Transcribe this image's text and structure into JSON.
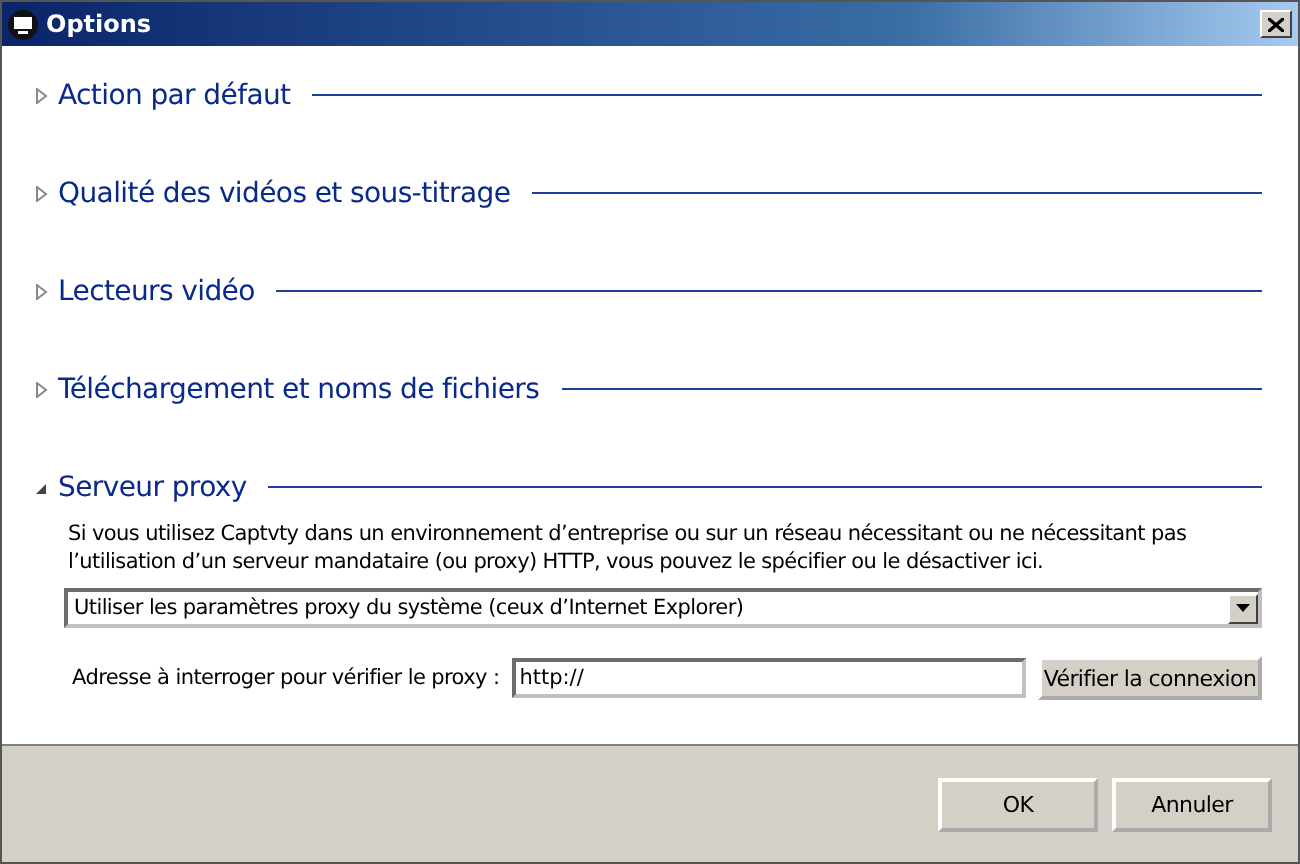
{
  "window": {
    "title": "Options"
  },
  "sections": [
    {
      "label": "Action par défaut",
      "expanded": false
    },
    {
      "label": "Qualité des vidéos et sous-titrage",
      "expanded": false
    },
    {
      "label": "Lecteurs vidéo",
      "expanded": false
    },
    {
      "label": "Téléchargement et noms de fichiers",
      "expanded": false
    },
    {
      "label": "Serveur proxy",
      "expanded": true,
      "description": "Si vous utilisez Captvty dans un environnement d’entreprise ou sur un réseau nécessitant ou ne nécessitant pas l’utilisation d’un serveur mandataire (ou proxy) HTTP, vous pouvez le spécifier ou le désactiver ici.",
      "proxy_mode": "Utiliser les paramètres proxy du système (ceux d’Internet Explorer)",
      "address_label": "Adresse à interroger pour vérifier le proxy :",
      "address_value": "http://",
      "check_button": "Vérifier la connexion"
    }
  ],
  "buttons": [
    "OK",
    "Annuler"
  ]
}
